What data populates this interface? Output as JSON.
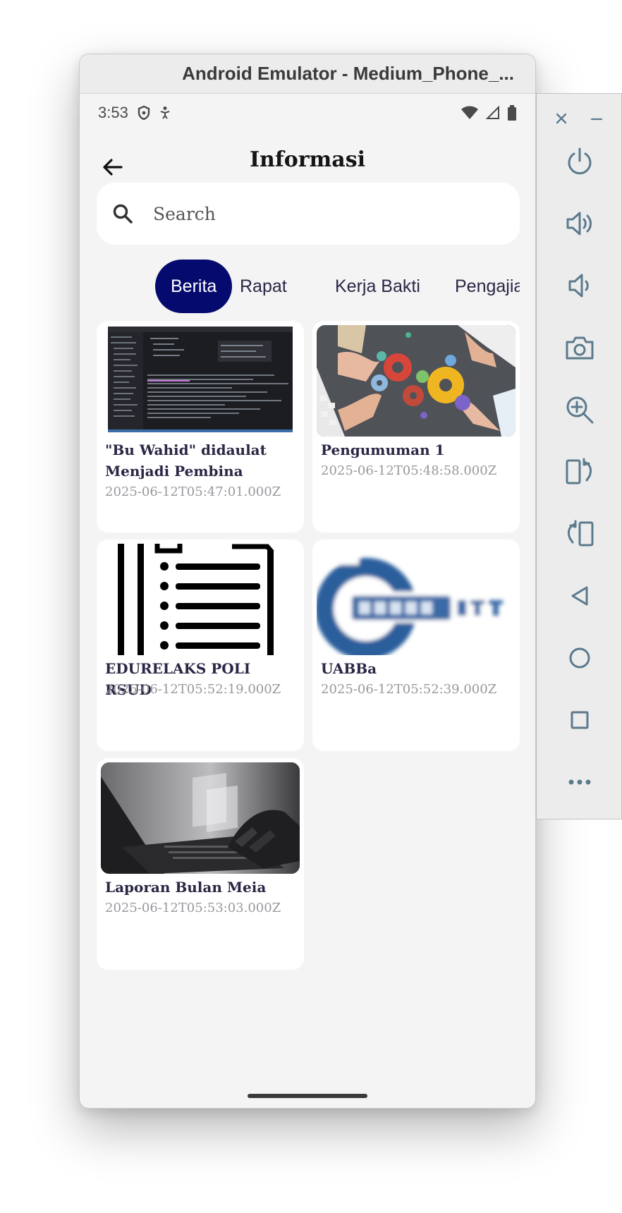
{
  "window": {
    "title": "Android Emulator - Medium_Phone_..."
  },
  "status_bar": {
    "time": "3:53"
  },
  "app_bar": {
    "title": "Informasi"
  },
  "search": {
    "placeholder": "Search"
  },
  "tabs": [
    {
      "label": "Berita",
      "active": true
    },
    {
      "label": "Rapat",
      "active": false
    },
    {
      "label": "Kerja Bakti",
      "active": false
    },
    {
      "label": "Pengajian",
      "active": false
    }
  ],
  "cards": [
    {
      "title": "\"Bu Wahid\" didaulat Menjadi Pembina",
      "date": "2025-06-12T05:47:01.000Z",
      "thumbnail": "code-editor-screenshot"
    },
    {
      "title": "Pengumuman 1",
      "date": "2025-06-12T05:48:58.000Z",
      "thumbnail": "gears-teamwork-photo"
    },
    {
      "title": "EDURELAKS POLI RSUD",
      "date": "2025-06-12T05:52:19.000Z",
      "thumbnail": "document-list-icon"
    },
    {
      "title": "UABBa",
      "date": "2025-06-12T05:52:39.000Z",
      "thumbnail": "blurred-logo"
    },
    {
      "title": "Laporan Bulan Meia",
      "date": "2025-06-12T05:53:03.000Z",
      "thumbnail": "laptop-typing-photo"
    }
  ],
  "emulator_controls": [
    "close-icon",
    "minimize-icon",
    "power-icon",
    "volume-up-icon",
    "volume-down-icon",
    "camera-icon",
    "zoom-icon",
    "rotate-left-icon",
    "rotate-right-icon",
    "back-icon",
    "home-icon",
    "overview-icon",
    "more-icon"
  ],
  "colors": {
    "accent": "#050a6e",
    "background": "#f4f4f5",
    "card": "#ffffff",
    "title_text": "#2a2745",
    "date_text": "#98989e"
  }
}
